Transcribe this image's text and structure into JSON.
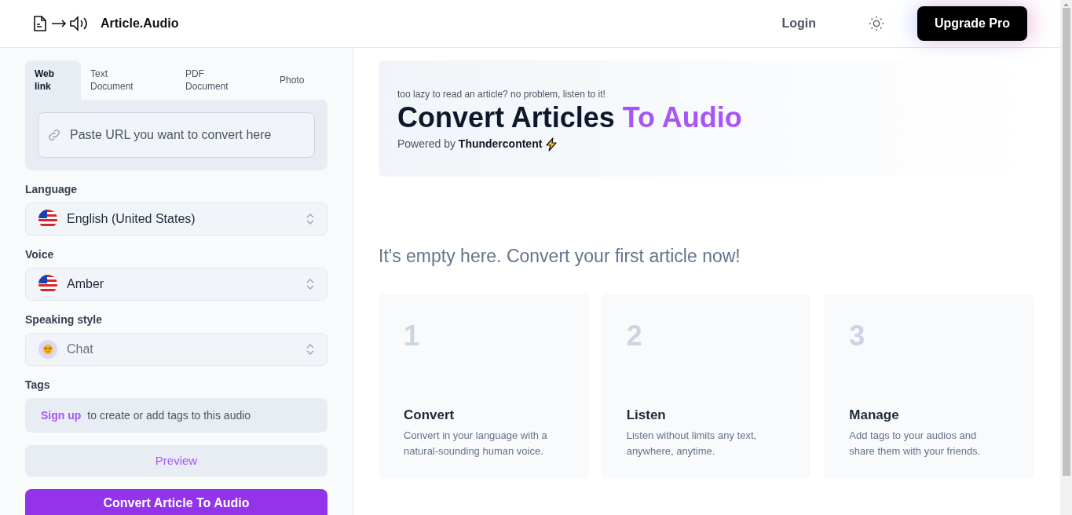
{
  "header": {
    "logo_text": "Article.Audio",
    "login": "Login",
    "upgrade": "Upgrade Pro"
  },
  "tabs": [
    {
      "label": "Web link",
      "selected": true
    },
    {
      "label": "Text Document",
      "selected": false
    },
    {
      "label": "PDF Document",
      "selected": false
    },
    {
      "label": "Photo",
      "selected": false
    }
  ],
  "url_field": {
    "placeholder": "Paste URL you want to convert here"
  },
  "selects": [
    {
      "label": "Language",
      "value": "English (United States)",
      "kind": "flag",
      "disabled": false
    },
    {
      "label": "Voice",
      "value": "Amber",
      "kind": "flag",
      "disabled": false
    },
    {
      "label": "Speaking style",
      "value": "Chat",
      "kind": "emoji",
      "disabled": true
    }
  ],
  "tags": {
    "label": "Tags",
    "link": "Sign up",
    "text": "to create or add tags to this audio"
  },
  "preview_button": "Preview",
  "convert_button": "Convert Article To Audio",
  "hero": {
    "tagline": "too lazy to read an article? no problem, listen to it!",
    "title_main": "Convert Articles",
    "title_accent": "To Audio",
    "powered_by": "Powered by",
    "brand": "Thundercontent"
  },
  "empty_message": "It's empty here. Convert your first article now!",
  "steps": [
    {
      "number": "1",
      "title": "Convert",
      "description": "Convert in your language with a natural-sounding human voice."
    },
    {
      "number": "2",
      "title": "Listen",
      "description": "Listen without limits any text, anywhere, anytime."
    },
    {
      "number": "3",
      "title": "Manage",
      "description": "Add tags to your audios and share them with your friends."
    }
  ]
}
